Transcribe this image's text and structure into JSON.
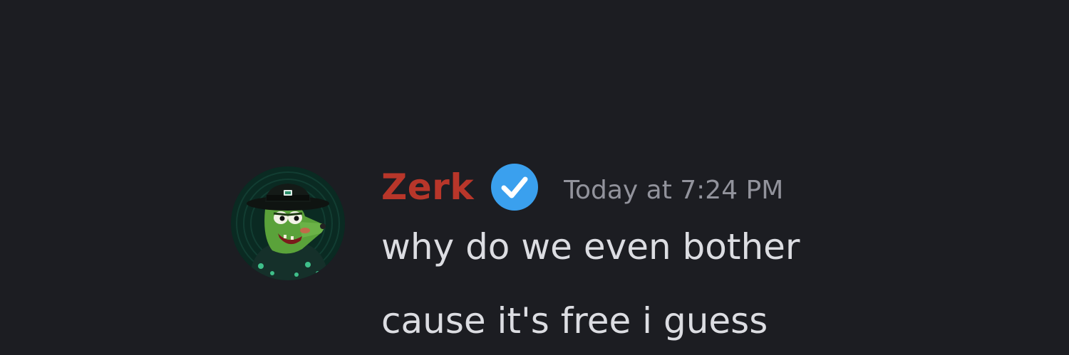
{
  "message": {
    "author": {
      "username": "Zerk",
      "username_color": "#b8362a",
      "verified": true,
      "verified_badge_color": "#3aa0ee",
      "avatar_icon": "cartoon-green-dog-with-hat-icon"
    },
    "timestamp": "Today at 7:24 PM",
    "lines": [
      "why do we even bother",
      "cause it's free i guess"
    ]
  },
  "colors": {
    "background": "#1c1d22",
    "message_text": "#dcdde2",
    "timestamp_text": "#92939c"
  }
}
